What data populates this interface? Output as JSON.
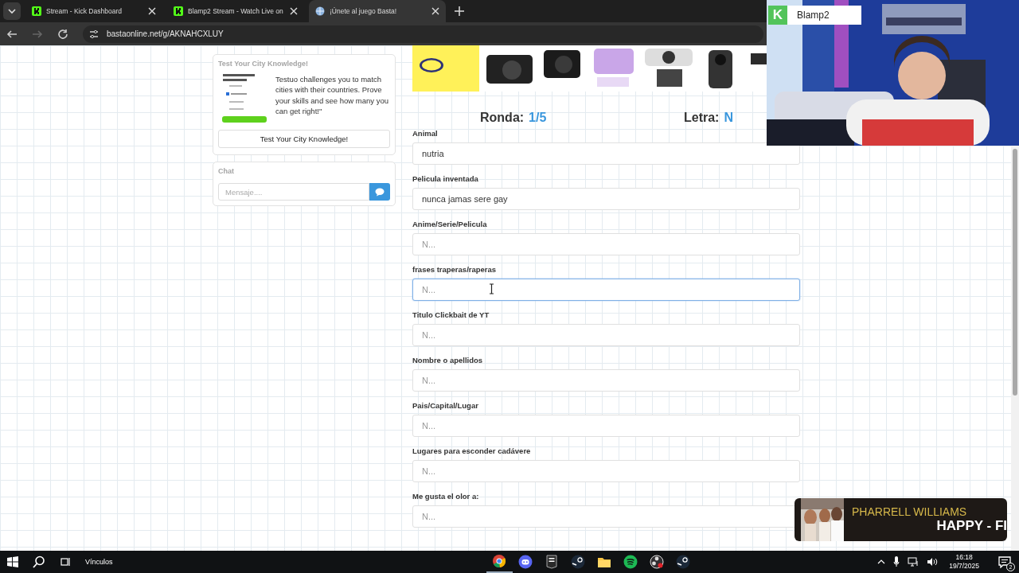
{
  "browser": {
    "tabs": [
      {
        "title": "Stream - Kick Dashboard",
        "kind": "kick",
        "selected": false
      },
      {
        "title": "Blamp2 Stream - Watch Live on",
        "kind": "kick",
        "selected": false
      },
      {
        "title": "¡Únete al juego Basta!",
        "kind": "site",
        "selected": true
      }
    ],
    "url": "bastaonline.net/g/AKNAHCXLUY"
  },
  "sidebar": {
    "quiz_card": {
      "title": "Test Your City Knowledge!",
      "text": "Testuo challenges you to match cities with their countries. Prove your skills and see how many you can get right!\"",
      "button": "Test Your City Knowledge!"
    },
    "chat": {
      "title": "Chat",
      "placeholder": "Mensaje...."
    }
  },
  "round": {
    "label": "Ronda:",
    "value": "1/5"
  },
  "letter": {
    "label": "Letra:",
    "value": "N"
  },
  "fields": [
    {
      "label": "Animal",
      "value": "nutria",
      "focused": false
    },
    {
      "label": "Pelicula inventada",
      "value": "nunca jamas sere gay",
      "focused": false
    },
    {
      "label": "Anime/Serie/Pelicula",
      "placeholder": "N...",
      "focused": false
    },
    {
      "label": "frases traperas/raperas",
      "placeholder": "N...",
      "focused": true
    },
    {
      "label": "Titulo Clickbait de YT",
      "placeholder": "N...",
      "focused": false
    },
    {
      "label": "Nombre o apellidos",
      "placeholder": "N...",
      "focused": false
    },
    {
      "label": "Pais/Capital/Lugar",
      "placeholder": "N...",
      "focused": false
    },
    {
      "label": "Lugares para esconder cadávere",
      "placeholder": "N...",
      "focused": false
    },
    {
      "label": "Me gusta el olor a:",
      "placeholder": "N...",
      "focused": false
    }
  ],
  "webcam": {
    "logo": "K",
    "channel": "Blamp2"
  },
  "now_playing": {
    "artist": "PHARRELL WILLIAMS",
    "title": "HAPPY - FI"
  },
  "taskbar": {
    "links_label": "Vínculos",
    "apps": [
      {
        "kind": "chrome"
      },
      {
        "kind": "discord"
      },
      {
        "kind": "epic"
      },
      {
        "kind": "steam"
      },
      {
        "kind": "folder"
      },
      {
        "kind": "spotify"
      },
      {
        "kind": "obs"
      },
      {
        "kind": "steam"
      }
    ],
    "time": "16:18",
    "date": "19/7/2025",
    "notifications": "2"
  }
}
